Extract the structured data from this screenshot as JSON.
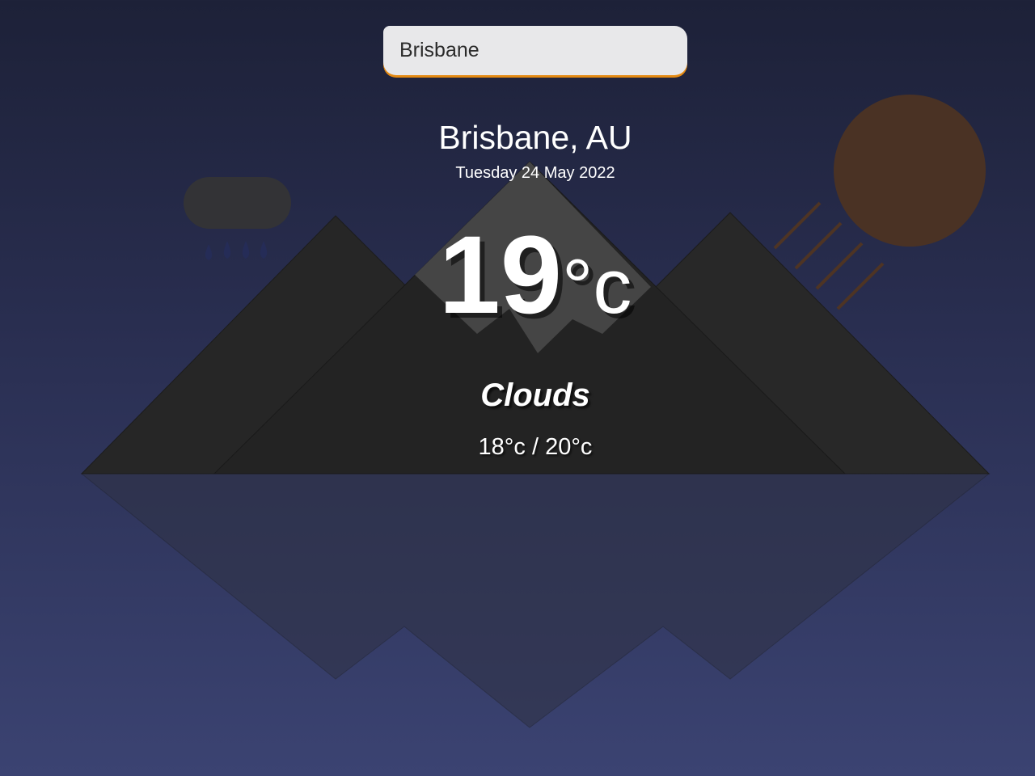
{
  "search": {
    "value": "Brisbane"
  },
  "weather": {
    "location": "Brisbane, AU",
    "date": "Tuesday 24 May 2022",
    "temp_number": "19",
    "temp_unit": "°c",
    "condition": "Clouds",
    "range": "18°c / 20°c"
  },
  "icons": [
    "rain-cloud-icon",
    "sun-icon"
  ],
  "colors": {
    "accent": "#e58a12",
    "sun": "#4e3424",
    "mountain": "#262626",
    "snow_cap": "#454545"
  }
}
